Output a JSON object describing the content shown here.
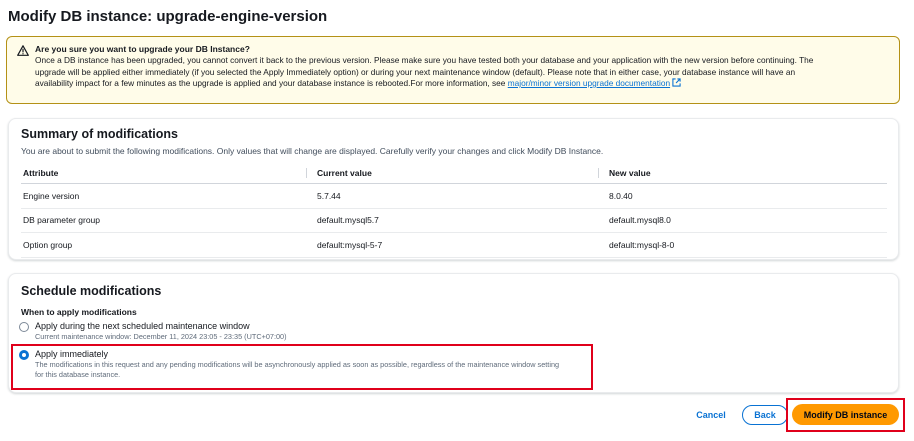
{
  "page": {
    "title": "Modify DB instance: upgrade-engine-version"
  },
  "warning": {
    "icon": "warning-icon",
    "title": "Are you sure you want to upgrade your DB Instance?",
    "line1": "Once a DB instance has been upgraded, you cannot convert it back to the previous version. Please make sure you have tested both your database and your application with the new version before continuing. The",
    "line2": "upgrade will be applied either immediately (if you selected the Apply Immediately option) or during your next maintenance window (default). Please note that in either case, your database instance will have an",
    "line3": "availability impact for a few minutes as the upgrade is applied and your database instance is rebooted.For more information, see",
    "link": "major/minor version upgrade documentation"
  },
  "summary": {
    "title": "Summary of modifications",
    "description": "You are about to submit the following modifications. Only values that will change are displayed. Carefully verify your changes and click Modify DB Instance.",
    "headers": {
      "attribute": "Attribute",
      "current": "Current value",
      "new": "New value"
    },
    "rows": [
      {
        "attribute": "Engine version",
        "current": "5.7.44",
        "new": "8.0.40"
      },
      {
        "attribute": "DB parameter group",
        "current": "default.mysql5.7",
        "new": "default.mysql8.0"
      },
      {
        "attribute": "Option group",
        "current": "default:mysql-5-7",
        "new": "default:mysql-8-0"
      }
    ]
  },
  "schedule": {
    "title": "Schedule modifications",
    "field_label": "When to apply modifications",
    "options": [
      {
        "label": "Apply during the next scheduled maintenance window",
        "description": "Current maintenance window: December 11, 2024 23:05 - 23:35 (UTC+07:00)",
        "selected": false
      },
      {
        "label": "Apply immediately",
        "description_line1": "The modifications in this request and any pending modifications will be asynchronously applied as soon as possible, regardless of the maintenance window setting",
        "description_line2": "for this database instance.",
        "selected": true
      }
    ]
  },
  "actions": {
    "cancel": "Cancel",
    "back": "Back",
    "modify": "Modify DB instance"
  },
  "colors": {
    "accent": "#0972d3",
    "primary_button": "#ff9900",
    "highlight": "#e0001b",
    "warning_bg": "#fffce9",
    "warning_border": "#b49116"
  }
}
